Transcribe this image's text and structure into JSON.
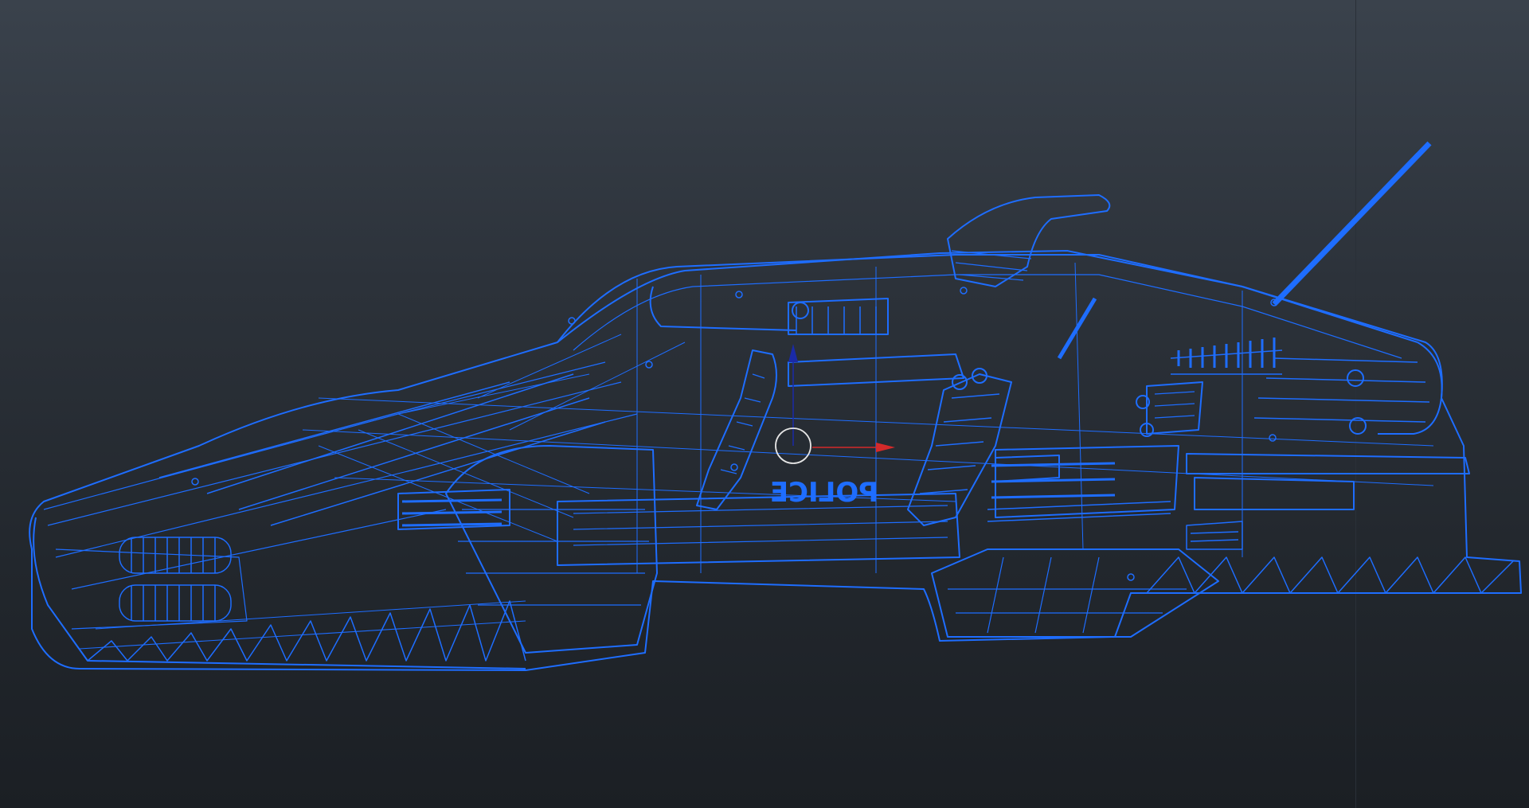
{
  "viewport": {
    "background_top": "#3a424c",
    "background_bottom": "#1b1f24",
    "wire_color": "#1e6dff",
    "gizmo_x_color": "#d42a2a",
    "gizmo_z_color": "#1a2aa8",
    "gizmo_center_color": "#e6e6e6",
    "decal_text": "POLICE"
  },
  "icons": {
    "transform_gizmo": "move-gizmo-icon",
    "pivot": "pivot-circle-icon"
  }
}
